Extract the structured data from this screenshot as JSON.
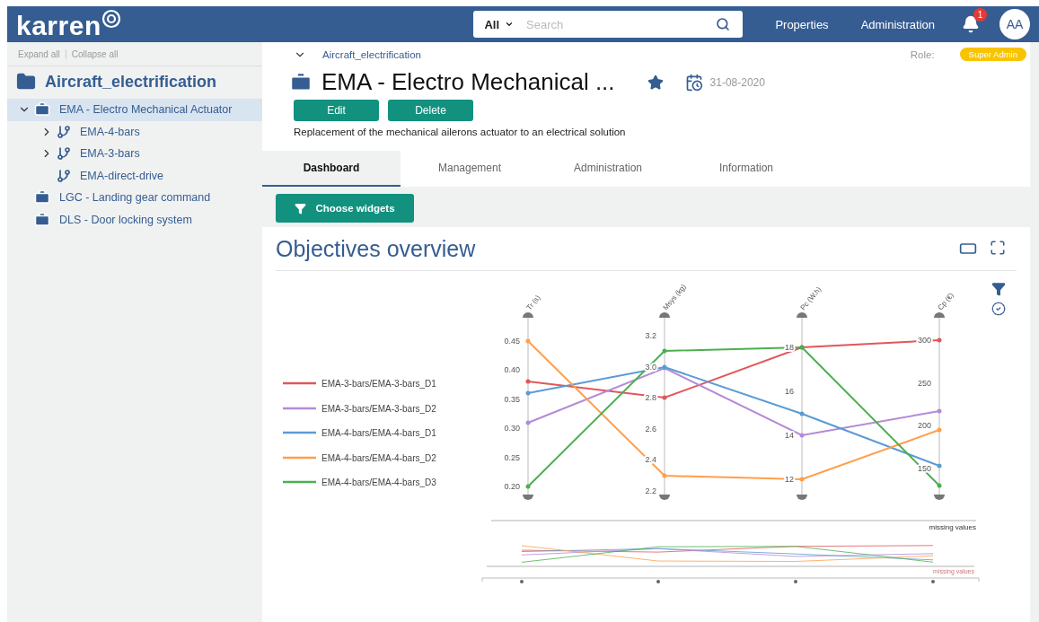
{
  "nav": {
    "logo": "karren",
    "search": {
      "scope": "All",
      "placeholder": "Search"
    },
    "links": [
      "Properties",
      "Administration"
    ],
    "notifications": "1",
    "avatar": "AA"
  },
  "sidebar": {
    "actions": [
      "Expand all",
      "Collapse all"
    ],
    "tree": {
      "label": "Aircraft_electrification",
      "children": [
        {
          "label": "EMA - Electro Mechanical Actuator",
          "kind": "project",
          "selected": true,
          "expandable": true,
          "expanded": true,
          "children": [
            {
              "label": "EMA-4-bars",
              "kind": "variant",
              "selected": false,
              "expandable": true,
              "expanded": false
            },
            {
              "label": "EMA-3-bars",
              "kind": "variant",
              "selected": false,
              "expandable": true,
              "expanded": false
            },
            {
              "label": "EMA-direct-drive",
              "kind": "variant",
              "selected": false,
              "expandable": false,
              "expanded": false
            }
          ]
        },
        {
          "label": "LGC - Landing gear command",
          "kind": "project",
          "selected": false,
          "expandable": false,
          "expanded": false
        },
        {
          "label": "DLS - Door locking system",
          "kind": "project",
          "selected": false,
          "expandable": false,
          "expanded": false
        }
      ]
    }
  },
  "header": {
    "breadcrumb": "Aircraft_electrification",
    "role_label": "Role:",
    "role": "Super Admin",
    "title": "EMA - Electro Mechanical ...",
    "favorite": true,
    "date": "31-08-2020",
    "buttons": [
      "Edit",
      "Delete"
    ],
    "description": "Replacement of the mechanical ailerons actuator to an electrical solution"
  },
  "tabs": [
    {
      "label": "Dashboard",
      "selected": true
    },
    {
      "label": "Management",
      "selected": false
    },
    {
      "label": "Administration",
      "selected": false
    },
    {
      "label": "Information",
      "selected": false
    }
  ],
  "toolbar": {
    "button": "Choose widgets"
  },
  "widget": {
    "title": "Objectives overview",
    "missing_labels": [
      "missing values",
      "missing values"
    ],
    "axes": [
      {
        "title": "Tr (s)",
        "ticks": [
          "0.45",
          "0.40",
          "0.35",
          "0.30",
          "0.25",
          "0.20"
        ]
      },
      {
        "title": "Msys (kg)",
        "ticks": [
          "3.2",
          "3.0",
          "2.8",
          "2.6",
          "2.4",
          "2.2"
        ]
      },
      {
        "title": "Pc (W.h)",
        "ticks": [
          "18",
          "16",
          "14",
          "12"
        ]
      },
      {
        "title": "Cp (€)",
        "ticks": [
          "300",
          "250",
          "200",
          "150"
        ]
      }
    ],
    "series": [
      {
        "name": "EMA-3-bars/EMA-3-bars_D1",
        "color": "#e0575b"
      },
      {
        "name": "EMA-3-bars/EMA-3-bars_D2",
        "color": "#b48ad8"
      },
      {
        "name": "EMA-4-bars/EMA-4-bars_D1",
        "color": "#5b9bd5"
      },
      {
        "name": "EMA-4-bars/EMA-4-bars_D2",
        "color": "#ff9f4a"
      },
      {
        "name": "EMA-4-bars/EMA-4-bars_D3",
        "color": "#4caf50"
      }
    ]
  }
}
